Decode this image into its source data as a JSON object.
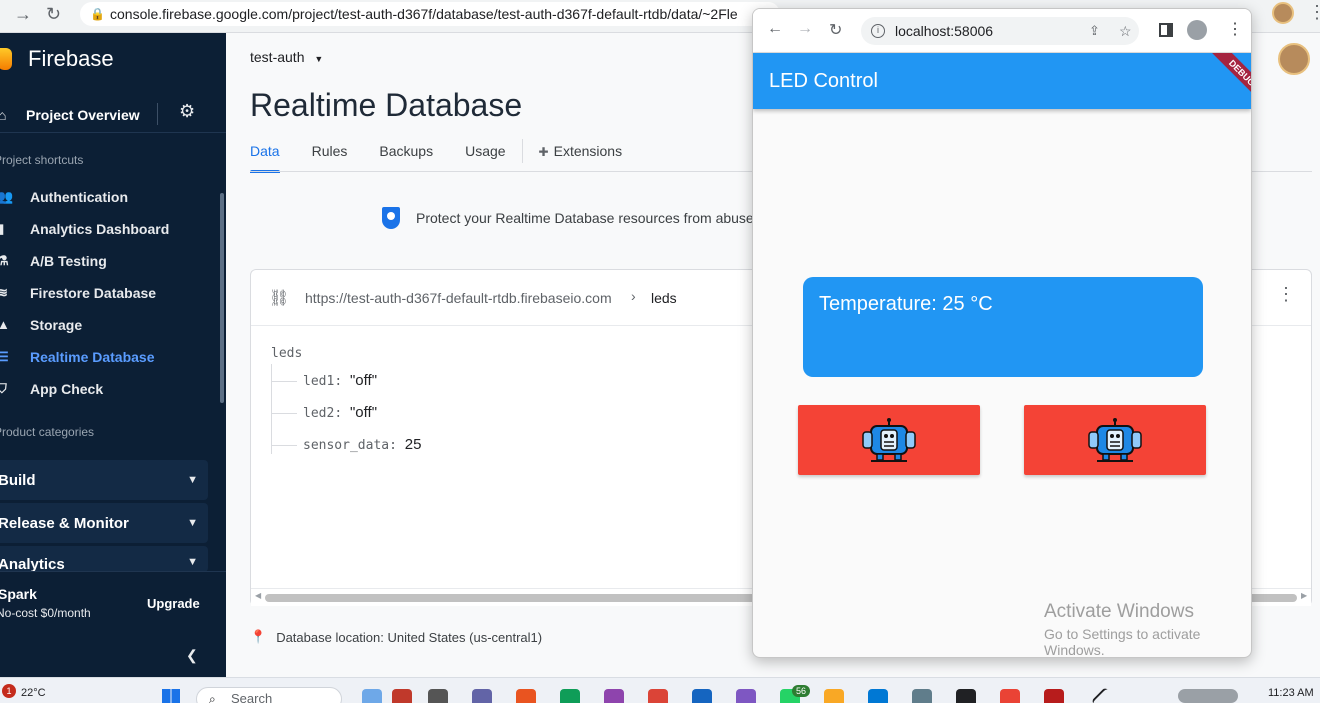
{
  "back_browser": {
    "url": "console.firebase.google.com/project/test-auth-d367f/database/test-auth-d367f-default-rtdb/data/~2Fle"
  },
  "sidebar": {
    "brand": "Firebase",
    "project_overview": "Project Overview",
    "shortcuts_label": "Project shortcuts",
    "items": [
      {
        "label": "Authentication",
        "icon": "users-icon"
      },
      {
        "label": "Analytics Dashboard",
        "icon": "bar-chart-icon"
      },
      {
        "label": "A/B Testing",
        "icon": "flask-icon"
      },
      {
        "label": "Firestore Database",
        "icon": "wifi-icon"
      },
      {
        "label": "Storage",
        "icon": "image-icon"
      },
      {
        "label": "Realtime Database",
        "icon": "database-icon",
        "active": true
      },
      {
        "label": "App Check",
        "icon": "shield-check-icon"
      }
    ],
    "categories_label": "Product categories",
    "categories": [
      "Build",
      "Release & Monitor",
      "Analytics"
    ],
    "plan": "Spark",
    "plan_cost": "No-cost $0/month",
    "upgrade": "Upgrade"
  },
  "main": {
    "project": "test-auth",
    "title": "Realtime Database",
    "tabs": [
      "Data",
      "Rules",
      "Backups",
      "Usage",
      "Extensions"
    ],
    "banner": "Protect your Realtime Database resources from abuse",
    "db_url": "https://test-auth-d367f-default-rtdb.firebaseio.com",
    "breadcrumb": "leds",
    "tree": {
      "root": "leds",
      "rows": [
        {
          "key": "led1",
          "value": "\"off\""
        },
        {
          "key": "led2",
          "value": "\"off\""
        },
        {
          "key": "sensor_data",
          "value": "25"
        }
      ]
    },
    "location": "Database location: United States (us-central1)"
  },
  "app_window": {
    "url": "localhost:58006",
    "app_title": "LED Control",
    "debug_banner": "DEBUG",
    "temperature_text": "Temperature: 25 °C",
    "led_buttons": [
      {
        "icon": "robot-icon",
        "color": "#f44336"
      },
      {
        "icon": "robot-icon",
        "color": "#f44336"
      }
    ],
    "watermark": {
      "line1": "Activate Windows",
      "line2": "Go to Settings to activate Windows."
    }
  },
  "taskbar": {
    "notification_badge": "1",
    "weather": "22°C",
    "search_placeholder": "Search",
    "whatsapp_count": "56",
    "time": "11:23 AM"
  },
  "colors": {
    "firebase_sidebar": "#0c1f35",
    "firebase_blue": "#1a73e8",
    "flutter_primary": "#2196f3",
    "led_off_red": "#f44336",
    "debug_ribbon": "#a5243f"
  }
}
